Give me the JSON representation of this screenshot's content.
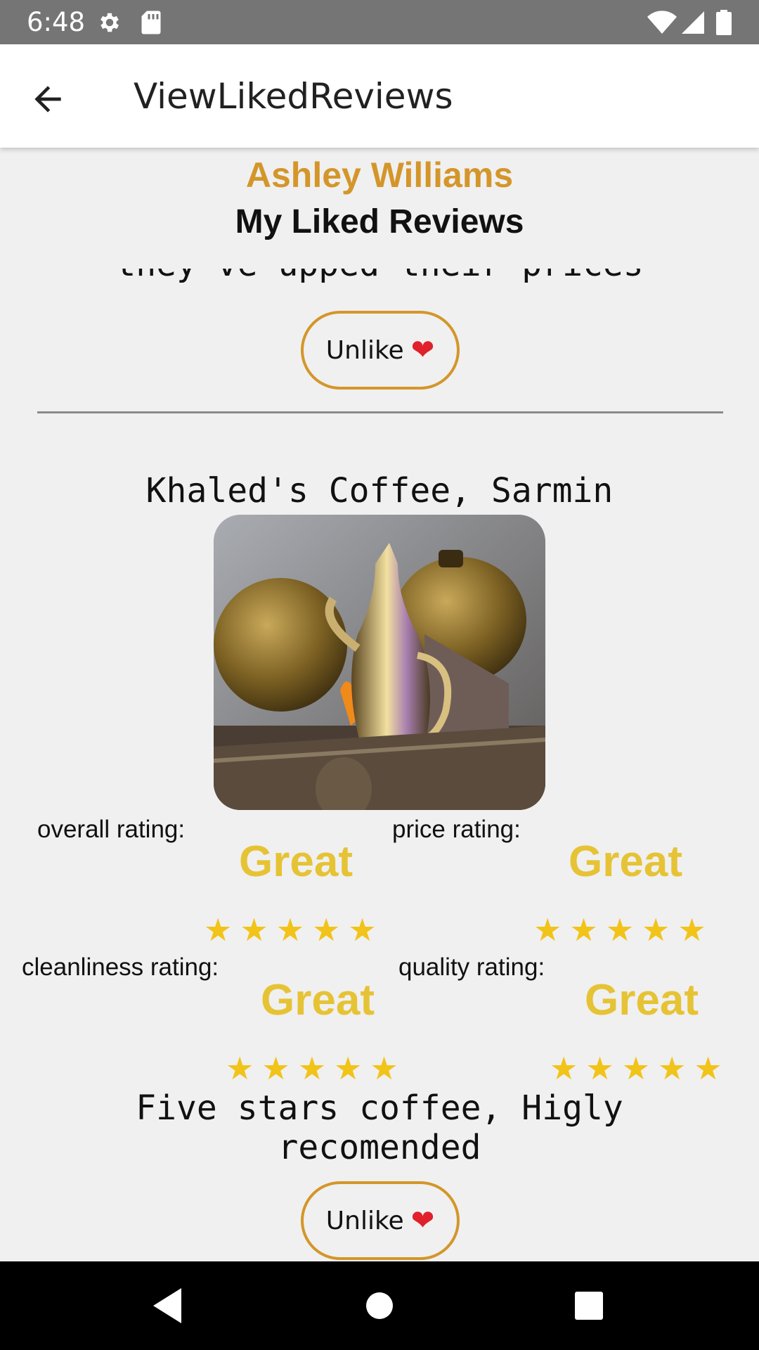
{
  "status_bar": {
    "time": "6:48",
    "icons": [
      "settings-icon",
      "sd-card-icon",
      "wifi-icon",
      "signal-icon",
      "battery-icon"
    ]
  },
  "app_bar": {
    "title": "ViewLikedReviews",
    "back_icon": "arrow-back-icon"
  },
  "header": {
    "user_name": "Ashley Williams",
    "section_title": "My Liked Reviews"
  },
  "previous_review": {
    "text_fragment": "they've upped their prices",
    "unlike_label": "Unlike",
    "heart_icon": "❤"
  },
  "review": {
    "place": "Khaled's Coffee, Sarmin",
    "ratings": [
      {
        "label": "overall rating:",
        "word": "Great",
        "stars": 5,
        "max": 5
      },
      {
        "label": "price rating:",
        "word": "Great",
        "stars": 5,
        "max": 5
      },
      {
        "label": "cleanliness rating:",
        "word": "Great",
        "stars": 5,
        "max": 5
      },
      {
        "label": "quality rating:",
        "word": "Great",
        "stars": 5,
        "max": 5
      }
    ],
    "text": "Five stars coffee, Higly recomended",
    "unlike_label": "Unlike",
    "heart_icon": "❤"
  },
  "colors": {
    "accent": "#d4962a",
    "rating_word": "#e6c335",
    "star": "#f2c318"
  },
  "nav_bar": {
    "icons": [
      "back-triangle-icon",
      "home-circle-icon",
      "recents-square-icon"
    ]
  }
}
